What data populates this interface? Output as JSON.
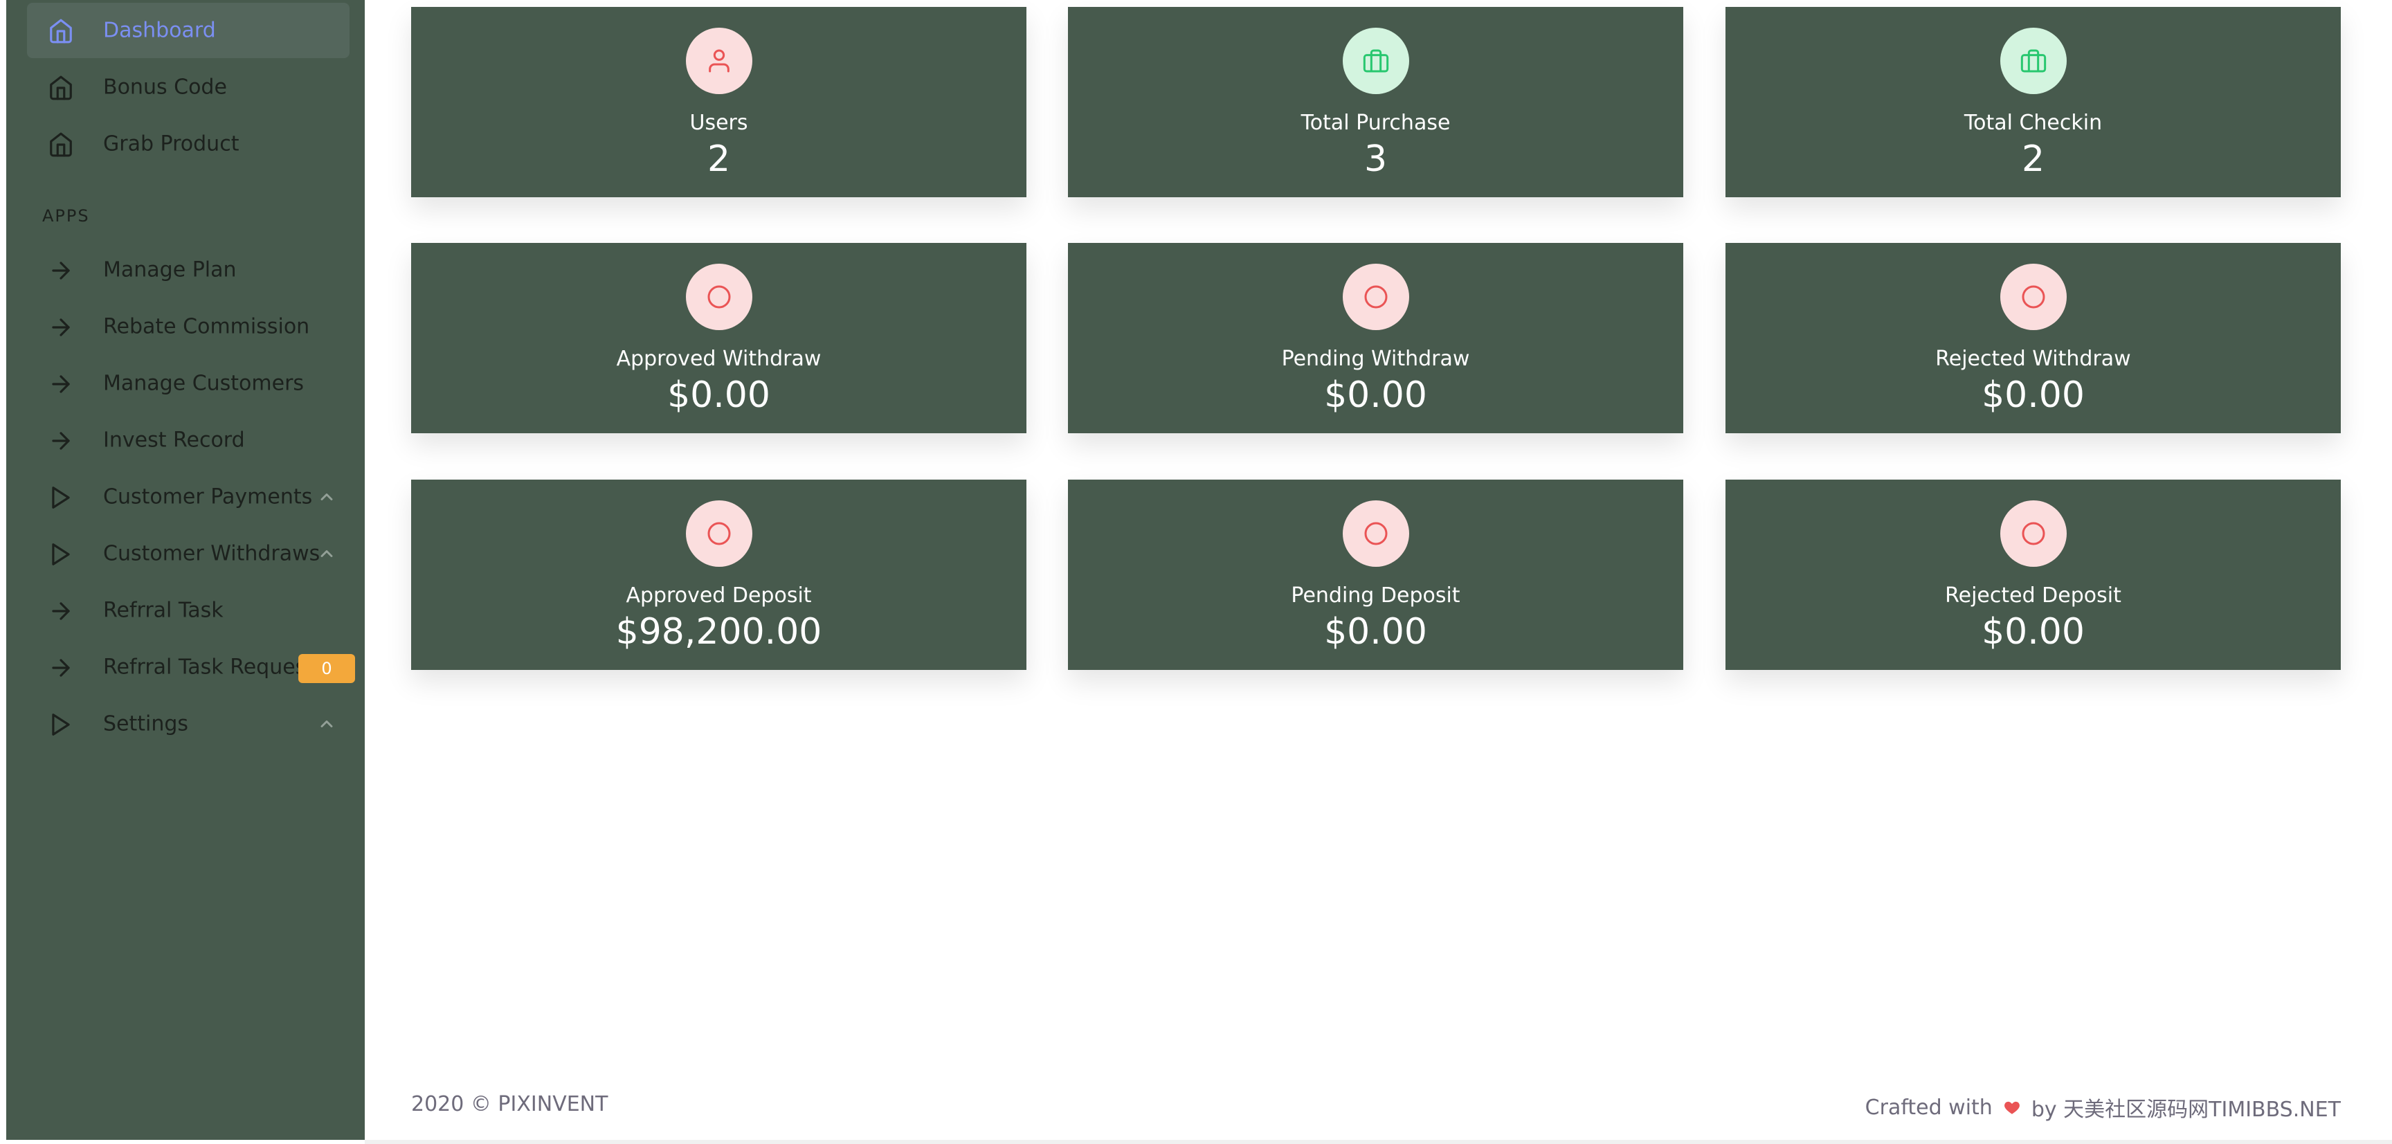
{
  "sidebar": {
    "items": [
      {
        "label": "Dashboard",
        "icon": "home-icon"
      },
      {
        "label": "Bonus Code",
        "icon": "home-icon"
      },
      {
        "label": "Grab Product",
        "icon": "home-icon"
      }
    ],
    "section_apps": "APPS",
    "apps": [
      {
        "label": "Manage Plan",
        "icon": "arrow-right-icon"
      },
      {
        "label": "Rebate Commission",
        "icon": "arrow-right-icon"
      },
      {
        "label": "Manage Customers",
        "icon": "arrow-right-icon"
      },
      {
        "label": "Invest Record",
        "icon": "arrow-right-icon"
      },
      {
        "label": "Customer Payments",
        "icon": "play-icon"
      },
      {
        "label": "Customer Withdraws",
        "icon": "play-icon"
      },
      {
        "label": "Refrral Task",
        "icon": "arrow-right-icon"
      },
      {
        "label": "Refrral Task Request",
        "icon": "arrow-right-icon",
        "badge": "0"
      },
      {
        "label": "Settings",
        "icon": "play-icon"
      }
    ]
  },
  "cards": [
    {
      "label": "Users",
      "value": "2",
      "icon": "user-icon"
    },
    {
      "label": "Total Purchase",
      "value": "3",
      "icon": "briefcase-icon"
    },
    {
      "label": "Total Checkin",
      "value": "2",
      "icon": "briefcase-icon"
    },
    {
      "label": "Approved Withdraw",
      "value": "$0.00",
      "icon": "circle-icon"
    },
    {
      "label": "Pending Withdraw",
      "value": "$0.00",
      "icon": "circle-icon"
    },
    {
      "label": "Rejected Withdraw",
      "value": "$0.00",
      "icon": "circle-icon"
    },
    {
      "label": "Approved Deposit",
      "value": "$98,200.00",
      "icon": "circle-icon"
    },
    {
      "label": "Pending Deposit",
      "value": "$0.00",
      "icon": "circle-icon"
    },
    {
      "label": "Rejected Deposit",
      "value": "$0.00",
      "icon": "circle-icon"
    }
  ],
  "footer": {
    "copyright": "2020 © PIXINVENT",
    "crafted_prefix": "Crafted with",
    "crafted_suffix": "by 天美社区源码网TIMIBBS.NET"
  },
  "colors": {
    "sidebar_bg": "#475a4d",
    "card_bg": "#475a4d",
    "active_text": "#7b8ff2",
    "badge": "#f3a83b",
    "icon_pink": "#ea5455",
    "icon_green": "#28c76f"
  }
}
